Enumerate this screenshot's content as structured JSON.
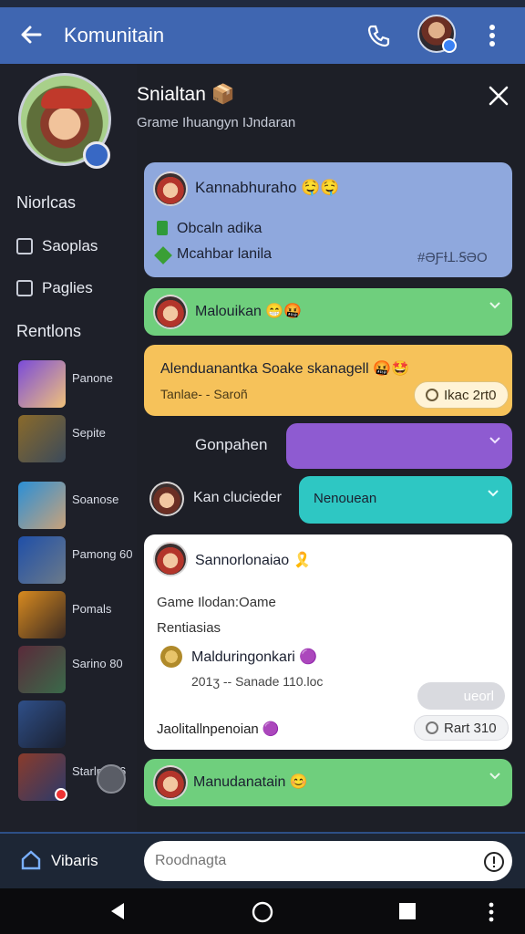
{
  "header": {
    "title": "Komunitain",
    "back_icon": "back-arrow-icon",
    "call_icon": "phone-icon",
    "more_icon": "more-vert-icon"
  },
  "sidebar": {
    "section1": "Niorlcas",
    "items": [
      {
        "label": "Saoplas",
        "icon": "checkbox-icon"
      },
      {
        "label": "Paglies",
        "icon": "checkbox-icon"
      }
    ],
    "section2": "Rentlons",
    "friends": [
      {
        "name": "Panone",
        "accent": "#7a4bd9"
      },
      {
        "name": "Sepite",
        "accent": "#8a6a2a"
      },
      {
        "name": "Soanose",
        "accent": "#2b8fd6"
      },
      {
        "name": "Pamong 60",
        "accent": "#1f4fa8"
      },
      {
        "name": "Pomals",
        "accent": "#d88a1f"
      },
      {
        "name": "Sarino 80",
        "accent": "#5a2a3a"
      },
      {
        "name": "",
        "accent": "#2f4f88"
      },
      {
        "name": "Starlng 06",
        "accent": "#8a3b2b"
      }
    ]
  },
  "panel": {
    "title": "Snialtan 📦",
    "subtitle": "Grame Ihuangyn IJndaran",
    "close_icon": "close-icon"
  },
  "cards": {
    "card1": {
      "name": "Kannabhuraho 🤤🤤",
      "line1": "Obcaln adika",
      "line2": "Mcahbar lanila",
      "meta": "#ƏƑƗꞱ.ꞨƏO",
      "bg": "#8fa8dd"
    },
    "card2": {
      "name": "Malouikan 😁🤬",
      "bg": "#6fcf7d"
    },
    "card3": {
      "name": "Alenduanantka Soake skanagell 🤬🤩",
      "sub": "Tanlae- - Saroñ",
      "pill": "Ikac 2rt0",
      "bg": "#f6c25a"
    },
    "card4": {
      "label": "Gonpahen",
      "bg": "#8e5bd1"
    },
    "card5": {
      "name": "Kan clucieder",
      "pill": "Nenouean",
      "bg": "#2ec7c3"
    },
    "card6": {
      "name": "Sannorlonaiao 🎗️",
      "line1": "Game Ilodan:Oame",
      "line2": "Rentiasias",
      "item": "Malduringonkari 🟣",
      "item_sub": "201ʒ -- Sanade 110.loc",
      "pill1": "ueorl",
      "footer": "Jaolitallnpenoian 🟣",
      "pill2": "Rart 310",
      "bg": "#ffffff"
    },
    "card7": {
      "name": "Manudanatain 😊",
      "bg": "#6fcf7d"
    }
  },
  "composer": {
    "nav_label": "Vibaris",
    "placeholder": "Roodnagta",
    "alert_icon": "alert-icon"
  },
  "system_nav": {
    "back": "back-triangle-icon",
    "home": "home-circle-icon",
    "recents": "recents-square-icon"
  }
}
